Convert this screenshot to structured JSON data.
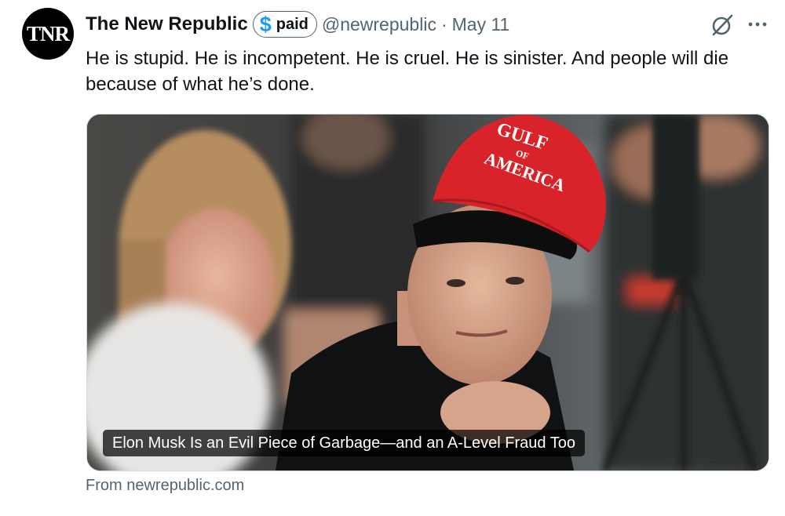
{
  "author": {
    "avatar_text": "TNR",
    "name": "The New Republic",
    "badge_label": "paid",
    "badge_symbol": "$",
    "handle": "@newrepublic",
    "separator": "·",
    "date": "May 11"
  },
  "tweet": {
    "text": "He is stupid. He is incompetent. He is cruel. He is sinister. And people will die because of what he’s done."
  },
  "card": {
    "title": "Elon Musk Is an Evil Piece of Garbage—and an A-Level Fraud Too",
    "hat_text": {
      "line1": "GULF",
      "line2": "OF",
      "line3": "AMERICA"
    },
    "source": "From newrepublic.com"
  },
  "icons": {
    "grok": "grok-icon",
    "more": "more-icon"
  },
  "colors": {
    "accent": "#1d9bf0",
    "secondary_text": "#536471",
    "hat_red": "#d9232b"
  }
}
